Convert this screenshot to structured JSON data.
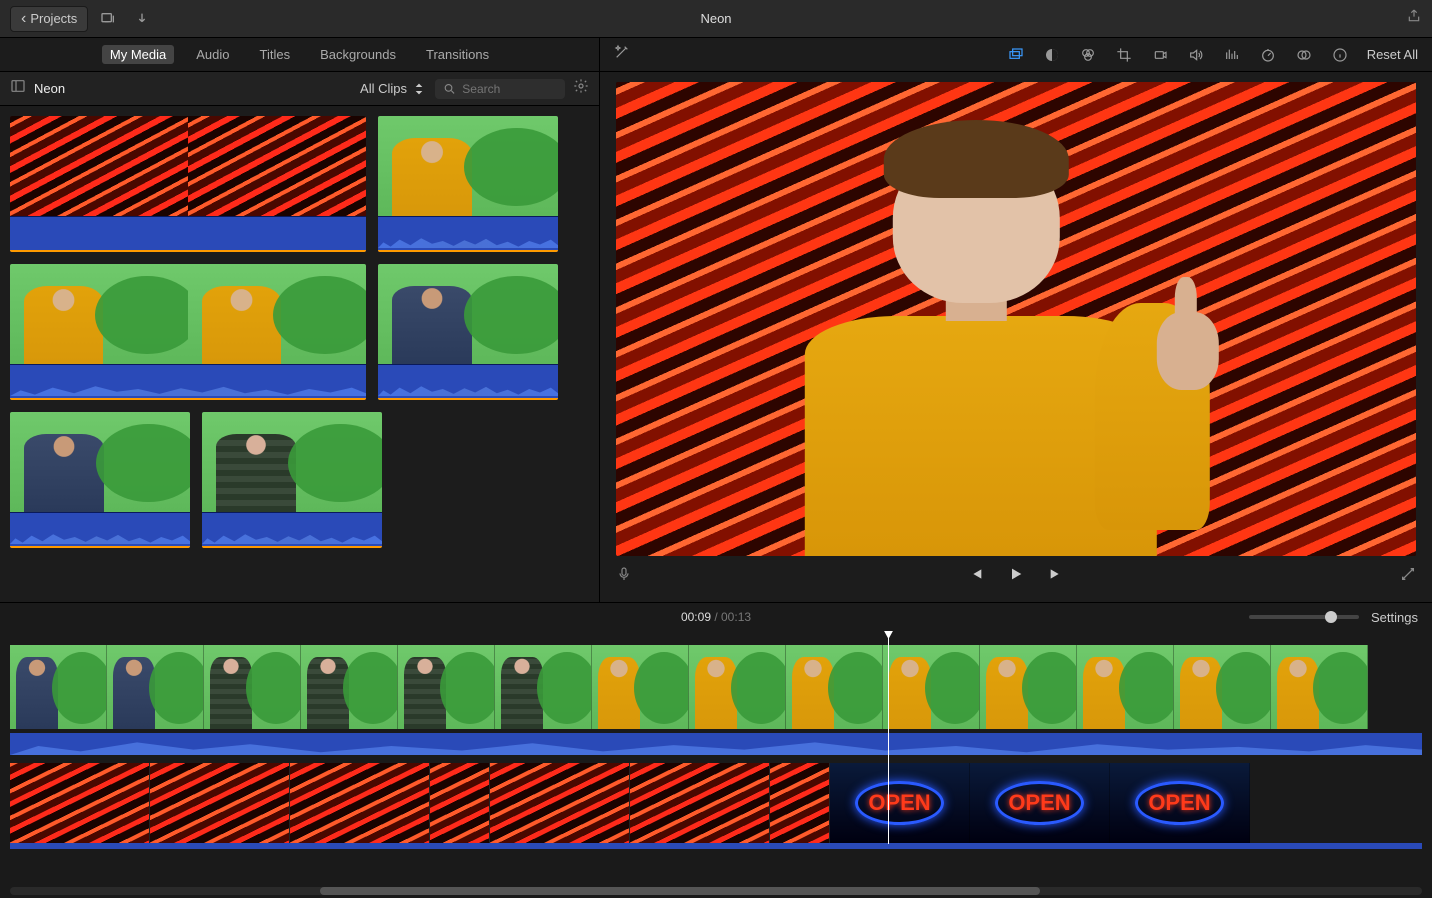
{
  "toolbar": {
    "back_label": "Projects",
    "project_title": "Neon"
  },
  "library": {
    "tabs": [
      "My Media",
      "Audio",
      "Titles",
      "Backgrounds",
      "Transitions"
    ],
    "active_tab_index": 0,
    "name": "Neon",
    "filter_label": "All Clips",
    "search_placeholder": "Search"
  },
  "adjust": {
    "reset_label": "Reset All"
  },
  "timeline": {
    "current_time": "00:09",
    "duration": "00:13",
    "settings_label": "Settings",
    "open_sign_text": "OPEN"
  }
}
